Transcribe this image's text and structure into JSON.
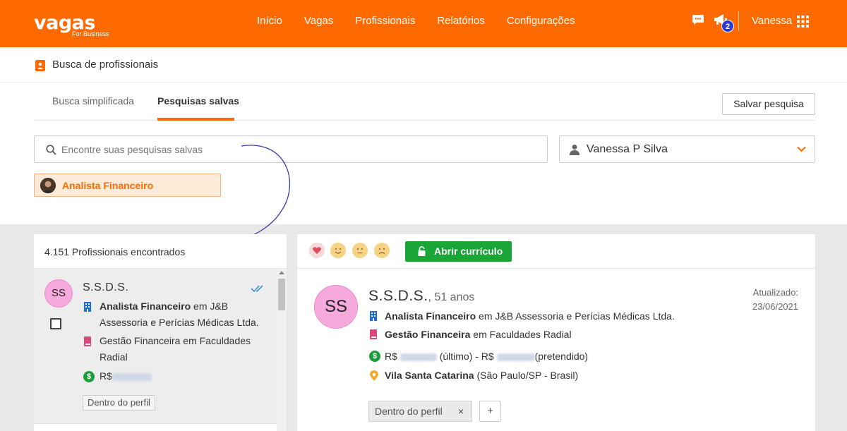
{
  "navbar": {
    "logo_main": "vagas",
    "logo_sub": "For Business",
    "links": [
      "Início",
      "Vagas",
      "Profissionais",
      "Relatórios",
      "Configurações"
    ],
    "notification_count": "2",
    "user_name": "Vanessa",
    "icons": [
      "chat-icon",
      "megaphone-icon",
      "apps-grid-icon"
    ]
  },
  "page": {
    "title": "Busca de profissionais",
    "tabs": [
      "Busca simplificada",
      "Pesquisas salvas"
    ],
    "active_tab": "Pesquisas salvas",
    "save_search_label": "Salvar pesquisa",
    "search_placeholder": "Encontre suas pesquisas salvas",
    "user_select_value": "Vanessa P Silva",
    "saved_search_chip": "Analista Financeiro",
    "accent_color": "#ff6a00"
  },
  "results": {
    "count_label": "4.151 Profissionais encontrados",
    "candidate": {
      "initials": "SS",
      "name": "S.S.D.S.",
      "job_title": "Analista Financeiro",
      "job_connector": "em",
      "job_company": "J&B Assessoria e Perícias Médicas Ltda.",
      "education_course": "Gestão Financeira",
      "education_connector": "em",
      "education_school": "Faculdades Radial",
      "salary_prefix": "R$",
      "tag": "Dentro do perfil"
    }
  },
  "detail": {
    "initials": "SS",
    "name": "S.S.D.S.",
    "age": ", 51 anos",
    "updated_label": "Atualizado:",
    "updated_date": "23/06/2021",
    "open_cv_label": "Abrir currículo",
    "job_title": "Analista Financeiro",
    "job_rest": "em J&B Assessoria e Perícias Médicas Ltda.",
    "education_course": "Gestão Financeira",
    "education_rest": "em Faculdades Radial",
    "salary_prefix": "R$",
    "salary_last_label": "(último) - R$",
    "salary_wanted_label": "(pretendido)",
    "location_neighborhood": "Vila Santa Catarina",
    "location_rest": "(São Paulo/SP - Brasil)",
    "tag": "Dentro do perfil",
    "tag_remove": "×",
    "add_tag": "+",
    "reactions": [
      "heart-icon",
      "happy-face-icon",
      "neutral-face-icon",
      "sad-face-icon"
    ]
  }
}
